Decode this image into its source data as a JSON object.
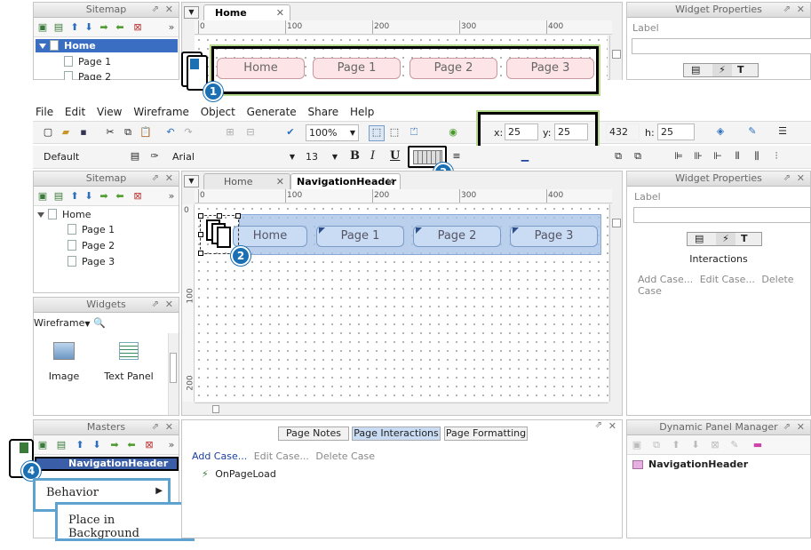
{
  "top_section": {
    "sitemap": {
      "title": "Sitemap",
      "items": [
        {
          "label": "Home",
          "selected": true
        },
        {
          "label": "Page 1"
        },
        {
          "label": "Page 2"
        }
      ]
    },
    "canvas_tab": "Home",
    "ruler_labels": [
      "0",
      "100",
      "200",
      "300",
      "400"
    ],
    "nav_buttons": [
      "Home",
      "Page 1",
      "Page 2",
      "Page 3"
    ],
    "widget_properties": {
      "title": "Widget Properties",
      "label": "Label"
    },
    "badge": "1"
  },
  "menubar": [
    "File",
    "Edit",
    "View",
    "Wireframe",
    "Object",
    "Generate",
    "Share",
    "Help"
  ],
  "toolbar": {
    "zoom": "100%",
    "style": "Default",
    "font": "Arial",
    "size": "13",
    "bold": "B",
    "italic": "I",
    "underline": "U",
    "x_label": "x:",
    "x_value": "25",
    "y_label": "y:",
    "y_value": "25",
    "w_value": "432",
    "h_label": "h:",
    "h_value": "25",
    "badge": "3"
  },
  "sitemap": {
    "title": "Sitemap",
    "items": [
      {
        "label": "Home"
      },
      {
        "label": "Page 1"
      },
      {
        "label": "Page 2"
      },
      {
        "label": "Page 3"
      }
    ]
  },
  "tabs": [
    {
      "label": "Home",
      "active": false
    },
    {
      "label": "NavigationHeader",
      "active": true
    }
  ],
  "canvas": {
    "ruler_labels": [
      "0",
      "100",
      "200",
      "300",
      "400"
    ],
    "vruler_labels": [
      "0",
      "100",
      "200"
    ],
    "nav_buttons": [
      "Home",
      "Page 1",
      "Page 2",
      "Page 3"
    ],
    "badge": "2"
  },
  "widget_properties": {
    "title": "Widget Properties",
    "label": "Label",
    "interactions_title": "Interactions",
    "add_case": "Add Case...",
    "edit_case": "Edit Case...",
    "delete_case": "Delete Case"
  },
  "widgets": {
    "title": "Widgets",
    "library": "Wireframe",
    "items": [
      {
        "label": "Image",
        "icon": "image-icon"
      },
      {
        "label": "Text Panel",
        "icon": "text-panel-icon"
      }
    ]
  },
  "masters": {
    "title": "Masters",
    "item": "NavigationHeader",
    "badge": "4"
  },
  "page_panel": {
    "tabs": [
      "Page Notes",
      "Page Interactions",
      "Page Formatting"
    ],
    "active_tab": "Page Interactions",
    "add_case": "Add Case...",
    "edit_case": "Edit Case...",
    "delete_case": "Delete Case",
    "event": "OnPageLoad"
  },
  "dynamic_panel_manager": {
    "title": "Dynamic Panel Manager",
    "item": "NavigationHeader"
  },
  "context_menu": {
    "behavior": "Behavior",
    "submenu_item": "Place in Background"
  },
  "colors": {
    "accent_blue": "#1b6fb3",
    "callout_green": "#b6d98e",
    "context_border": "#5ea3cf",
    "pink_button": "#fde4e6",
    "blue_button": "#c9dcf3"
  }
}
